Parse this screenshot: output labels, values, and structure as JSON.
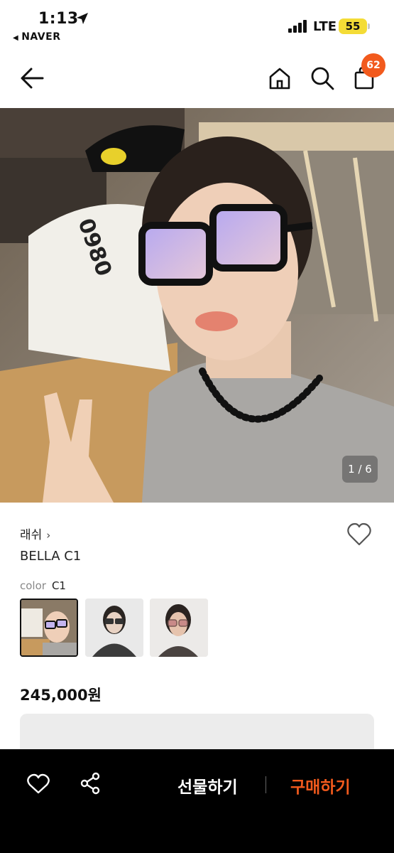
{
  "status_bar": {
    "time": "1:13",
    "back_app": "NAVER",
    "network": "LTE",
    "battery": "55"
  },
  "nav": {
    "cart_badge": "62"
  },
  "gallery": {
    "counter": "1 / 6"
  },
  "product": {
    "brand": "래쉬",
    "name": "BELLA C1",
    "color_label": "color",
    "color_value": "C1",
    "price": "245,000원"
  },
  "bottom_bar": {
    "gift_label": "선물하기",
    "buy_label": "구매하기"
  },
  "colors": {
    "accent": "#f25a1d",
    "battery": "#f4dc36"
  }
}
